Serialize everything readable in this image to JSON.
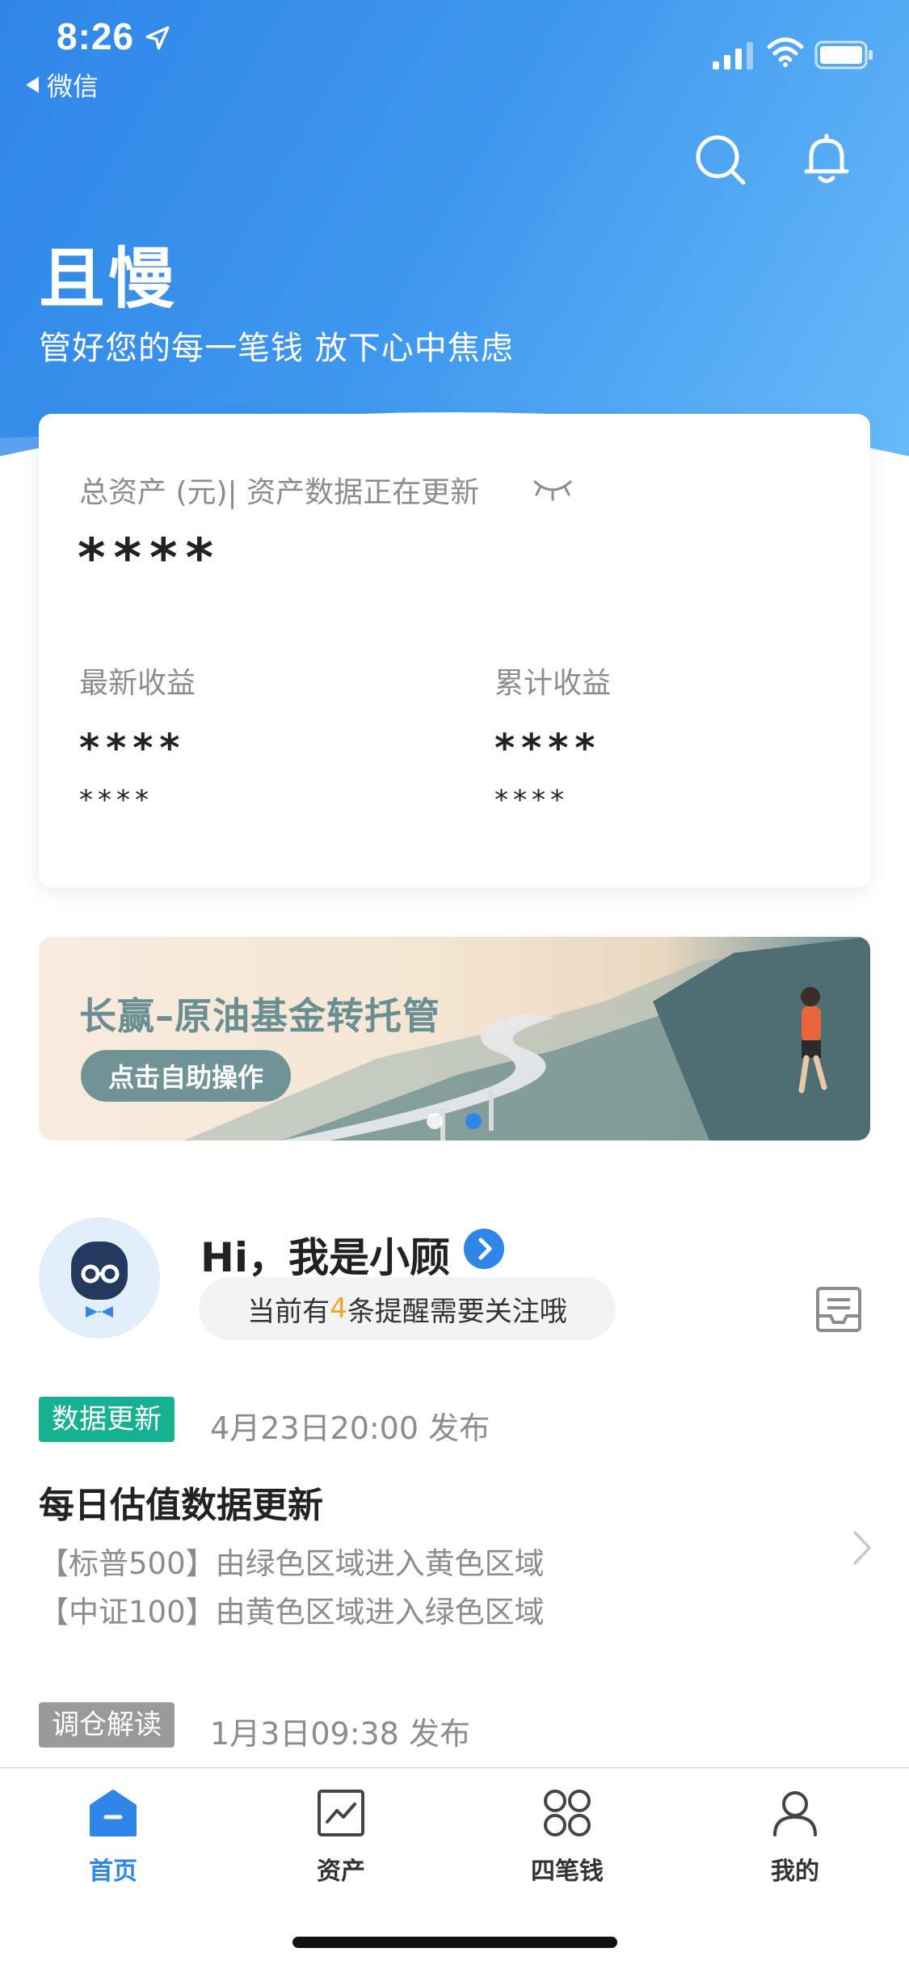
{
  "status_bar": {
    "time": "8:26",
    "back_app": "微信",
    "icons": [
      "location-arrow-icon",
      "signal-icon",
      "wifi-icon",
      "battery-icon"
    ]
  },
  "header": {
    "brand": "且慢",
    "slogan": "管好您的每一笔钱 放下心中焦虑",
    "icons": [
      "search-icon",
      "bell-icon"
    ]
  },
  "asset_card": {
    "label": "总资产 (元)| 资产数据正在更新",
    "total": "****",
    "latest_label": "最新收益",
    "latest_value": "****",
    "latest_sub": "****",
    "cumulative_label": "累计收益",
    "cumulative_value": "****",
    "cumulative_sub": "****",
    "icons": [
      "eye-closed-icon"
    ]
  },
  "banner": {
    "title": "长赢–原油基金转托管",
    "button": "点击自助操作",
    "slides": 2,
    "active_slide": 2
  },
  "assistant": {
    "hi": "Hi，我是小顾",
    "remind_prefix": "当前有",
    "remind_count": "4",
    "remind_suffix": "条提醒需要关注哦"
  },
  "feed": [
    {
      "tag": "数据更新",
      "date": "4月23日20:00 发布",
      "title": "每日估值数据更新",
      "lines": [
        "【标普500】由绿色区域进入黄色区域",
        "【中证100】由黄色区域进入绿色区域"
      ]
    },
    {
      "tag": "调仓解读",
      "date": "1月3日09:38 发布"
    }
  ],
  "tabbar": [
    {
      "label": "首页",
      "icon": "home-icon",
      "active": true
    },
    {
      "label": "资产",
      "icon": "chart-icon",
      "active": false
    },
    {
      "label": "四笔钱",
      "icon": "four-circles-icon",
      "active": false
    },
    {
      "label": "我的",
      "icon": "user-icon",
      "active": false
    }
  ],
  "colors": {
    "primary": "#2f86e8",
    "accent_orange": "#f5a623",
    "tag_green": "#15b190",
    "tag_gray": "#9a9a9a"
  }
}
